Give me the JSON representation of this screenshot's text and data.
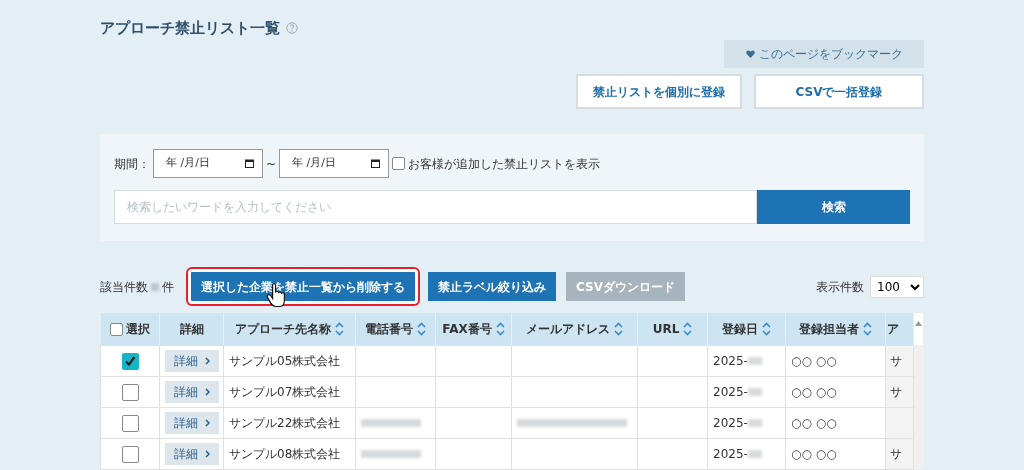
{
  "title": "アプローチ禁止リスト一覧",
  "bookmark_button": "このページをブックマーク",
  "register_buttons": [
    "禁止リストを個別に登録",
    "CSVで一括登録"
  ],
  "filter": {
    "period_label": "期間：",
    "date_from": "年 /月/日",
    "separator": "~",
    "date_to": "年 /月/日",
    "customer_only": {
      "label": "お客様が追加した禁止リストを表示",
      "checked": false
    },
    "search_placeholder": "検索したいワードを入力してください",
    "search_button": "検索"
  },
  "count_label": "該当件数",
  "count_unit": "件",
  "actions": [
    {
      "label": "選択した企業を禁止一覧から削除する",
      "disabled": false,
      "highlighted": true
    },
    {
      "label": "禁止ラベル絞り込み",
      "disabled": false,
      "highlighted": false
    },
    {
      "label": "CSVダウンロード",
      "disabled": true,
      "highlighted": false
    }
  ],
  "page_size": {
    "label": "表示件数",
    "value": "100"
  },
  "table": {
    "select_all": {
      "label": "選択",
      "checked": false
    },
    "columns": [
      {
        "label": "詳細",
        "sortable": false
      },
      {
        "label": "アプローチ先名称",
        "sortable": true
      },
      {
        "label": "電話番号",
        "sortable": true
      },
      {
        "label": "FAX番号",
        "sortable": true
      },
      {
        "label": "メールアドレス",
        "sortable": true
      },
      {
        "label": "URL",
        "sortable": true
      },
      {
        "label": "登録日",
        "sortable": true
      },
      {
        "label": "登録担当者",
        "sortable": true
      },
      {
        "label": "ア",
        "sortable": false
      }
    ],
    "rows": [
      {
        "selected": true,
        "detail": "詳細",
        "name": "サンプル05株式会社",
        "phone_masked": false,
        "email_masked": false,
        "date": "2025-",
        "staff": "○○ ○○",
        "column_9": "サ"
      },
      {
        "selected": false,
        "detail": "詳細",
        "name": "サンプル07株式会社",
        "phone_masked": false,
        "email_masked": false,
        "date": "2025-",
        "staff": "○○ ○○",
        "column_9": "サ"
      },
      {
        "selected": false,
        "detail": "詳細",
        "name": "サンプル22株式会社",
        "phone_masked": true,
        "email_masked": true,
        "date": "2025-",
        "staff": "○○ ○○",
        "column_9": ""
      },
      {
        "selected": false,
        "detail": "詳細",
        "name": "サンプル08株式会社",
        "phone_masked": true,
        "email_masked": false,
        "date": "2025-",
        "staff": "○○ ○○",
        "column_9": "サ"
      }
    ]
  }
}
